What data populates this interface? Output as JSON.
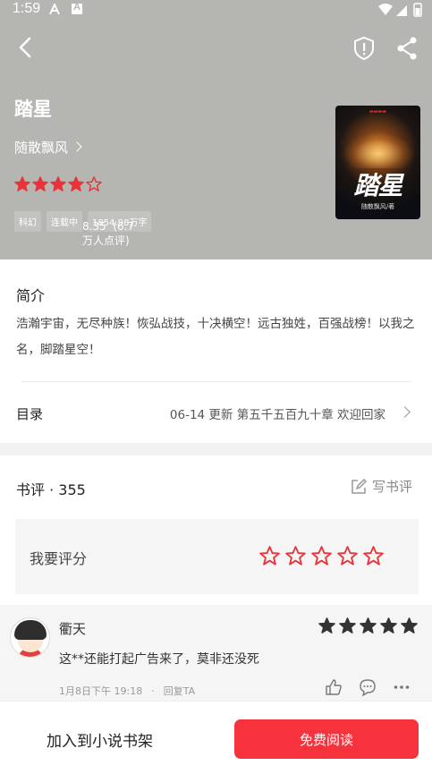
{
  "status_bar": {
    "time": "1:59"
  },
  "book": {
    "title": "踏星",
    "author": "随散飘风",
    "rating": 8.35,
    "rating_count": "(6.7万人点评)",
    "rating_stars_filled": 4,
    "tags": [
      "科幻",
      "连载中",
      "1854.98万字"
    ],
    "cover_title": "踏星",
    "cover_author": "随散飘风/著"
  },
  "intro": {
    "heading": "简介",
    "text": "浩瀚宇宙，无尽种族！恢弘战技，十决横空！远古独姓，百强战榜！以我之名，脚踏星空！"
  },
  "toc": {
    "label": "目录",
    "latest": "06-14  更新  第五千五百九十章 欢迎回家"
  },
  "reviews": {
    "heading": "书评 · 355",
    "write_label": "写书评",
    "rate_label": "我要评分",
    "items": [
      {
        "name": "衢天",
        "stars": 5,
        "text": "这**还能打起广告来了，莫非还没死",
        "time": "1月8日下午 19:18",
        "reply": "回复TA"
      }
    ]
  },
  "bottom_bar": {
    "add_label": "加入到小说书架",
    "read_label": "免费阅读"
  },
  "colors": {
    "accent": "#f6323d",
    "star": "#e8333a",
    "hero_bg": "#b5b6b1"
  }
}
